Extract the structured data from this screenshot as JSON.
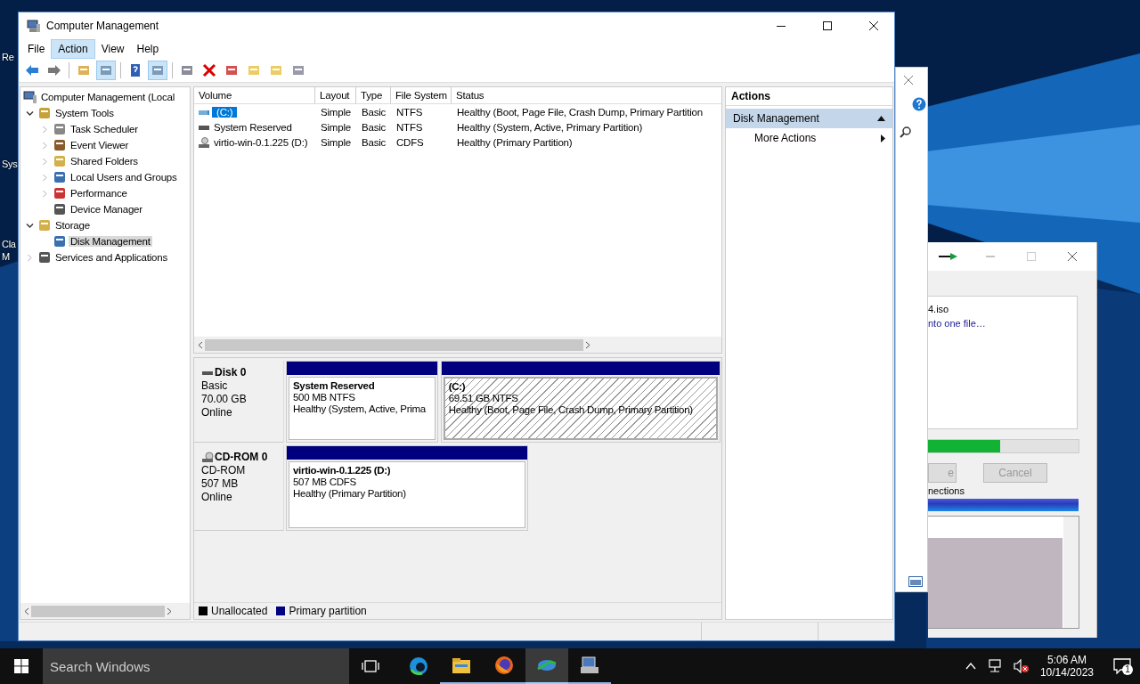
{
  "desktop_icons": [
    {
      "label": "Re"
    },
    {
      "label": "Sys"
    },
    {
      "label": "Cla"
    },
    {
      "label": "M"
    }
  ],
  "window": {
    "title": "Computer Management"
  },
  "menu": [
    {
      "label": "File",
      "selected": false
    },
    {
      "label": "Action",
      "selected": true
    },
    {
      "label": "View",
      "selected": false
    },
    {
      "label": "Help",
      "selected": false
    }
  ],
  "toolbar": [
    {
      "selected": false
    },
    {
      "selected": false
    },
    {
      "selected": false
    },
    {
      "selected": true
    },
    {
      "selected": false
    },
    {
      "selected": true
    },
    {
      "selected": false
    },
    {
      "selected": false
    },
    {
      "selected": false
    },
    {
      "selected": false
    },
    {
      "selected": false
    },
    {
      "selected": false
    }
  ],
  "tree": {
    "root": "Computer Management (Local",
    "items": [
      {
        "label": "System Tools",
        "expanded": true,
        "selected": false,
        "children": [
          {
            "label": "Task Scheduler",
            "expanded": false,
            "selected": false
          },
          {
            "label": "Event Viewer",
            "expanded": false,
            "selected": false
          },
          {
            "label": "Shared Folders",
            "expanded": false,
            "selected": false
          },
          {
            "label": "Local Users and Groups",
            "expanded": false,
            "selected": false
          },
          {
            "label": "Performance",
            "expanded": false,
            "selected": false
          },
          {
            "label": "Device Manager",
            "selected": false
          }
        ]
      },
      {
        "label": "Storage",
        "expanded": true,
        "selected": false,
        "children": [
          {
            "label": "Disk Management",
            "selected": true
          }
        ]
      },
      {
        "label": "Services and Applications",
        "expanded": false,
        "selected": false
      }
    ]
  },
  "volumes": {
    "columns": [
      "Volume",
      "Layout",
      "Type",
      "File System",
      "Status"
    ],
    "rows": [
      {
        "cells": [
          "(C:)",
          "Simple",
          "Basic",
          "NTFS",
          "Healthy (Boot, Page File, Crash Dump, Primary Partition"
        ],
        "selected": true
      },
      {
        "cells": [
          "System Reserved",
          "Simple",
          "Basic",
          "NTFS",
          "Healthy (System, Active, Primary Partition)"
        ],
        "selected": false
      },
      {
        "cells": [
          "virtio-win-0.1.225 (D:)",
          "Simple",
          "Basic",
          "CDFS",
          "Healthy (Primary Partition)"
        ],
        "selected": false
      }
    ]
  },
  "disks": [
    {
      "name": "Disk 0",
      "kind": "disk",
      "type": "Basic",
      "size": "70.00 GB",
      "status": "Online",
      "partitions": [
        {
          "name": "System Reserved",
          "size": "500 MB NTFS",
          "status": "Healthy (System, Active, Prima",
          "selected": false
        },
        {
          "name": "(C:)",
          "size": "69.51 GB NTFS",
          "status": "Healthy (Boot, Page File, Crash Dump, Primary Partition)",
          "selected": true
        }
      ]
    },
    {
      "name": "CD-ROM 0",
      "kind": "cdrom",
      "type": "CD-ROM",
      "size": "507 MB",
      "status": "Online",
      "partitions": [
        {
          "name": "virtio-win-0.1.225  (D:)",
          "size": "507 MB CDFS",
          "status": "Healthy (Primary Partition)",
          "selected": false
        }
      ]
    }
  ],
  "legend": [
    {
      "label": "Unallocated",
      "color": "#000000"
    },
    {
      "label": "Primary partition",
      "color": "#000080"
    }
  ],
  "actions": {
    "title": "Actions",
    "section": {
      "label": "Disk Management",
      "expanded": true
    },
    "items": [
      {
        "label": "More Actions"
      }
    ]
  },
  "download_window": {
    "file": "4.iso",
    "link": "nto one file…",
    "progress": {
      "level": 0.48
    },
    "buttons": [
      {
        "label": "e",
        "disabled": true
      },
      {
        "label": "Cancel",
        "disabled": true
      }
    ],
    "section": "nections"
  },
  "taskbar": {
    "search": {
      "placeholder": "Search Windows"
    },
    "apps": [
      {
        "running": false,
        "selected": false
      },
      {
        "running": true,
        "selected": false
      },
      {
        "running": true,
        "selected": false
      },
      {
        "running": true,
        "selected": true
      },
      {
        "running": true,
        "selected": false
      }
    ],
    "time": "5:06 AM",
    "date": "10/14/2023",
    "notifications": "1"
  }
}
